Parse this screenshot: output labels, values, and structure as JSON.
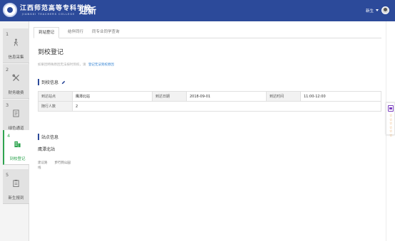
{
  "header": {
    "school_name": "江西师范高等专科学校",
    "school_name_en": "JIANGXI TEACHERS COLLEGE",
    "app_title": "迎新",
    "user": {
      "name": "新生"
    }
  },
  "sidebar": {
    "items": [
      {
        "number": "1",
        "label": "信息采集",
        "icon": "person-icon"
      },
      {
        "number": "2",
        "label": "财务缴费",
        "icon": "tools-icon"
      },
      {
        "number": "3",
        "label": "绿色通道",
        "icon": "document-icon"
      },
      {
        "number": "4",
        "label": "到校登记",
        "icon": "building-icon",
        "active": true
      },
      {
        "number": "5",
        "label": "新生报到",
        "icon": "clipboard-icon"
      }
    ]
  },
  "tabs": [
    {
      "label": "到站登记",
      "active": true
    },
    {
      "label": "结伴同行"
    },
    {
      "label": "同专业同学查询"
    }
  ],
  "main": {
    "page_title": "到校登记",
    "hint_text": "如果因特殊原因无法按时到校，请",
    "hint_link": "登记无法到校原因",
    "arrival_section_title": "到校信息",
    "table": [
      [
        {
          "key": "到达站点",
          "value": "鹰潭北站"
        },
        {
          "key": "到达日期",
          "value": "2018-09-01"
        },
        {
          "key": "到达时间",
          "value": "11:00-12:00"
        }
      ],
      [
        {
          "key": "随行人数",
          "value": "2"
        }
      ]
    ],
    "station_section_title": "站点信息",
    "station_name": "鹰潭北站",
    "route_label": "建议路线",
    "route_value": "步行到公园"
  },
  "float_panel": {
    "dots": "☆☆☆☆☆☆"
  },
  "colors": {
    "header_bg": "#2c4a9a",
    "active_nav": "#2ea44f",
    "link": "#2d7fd1"
  }
}
